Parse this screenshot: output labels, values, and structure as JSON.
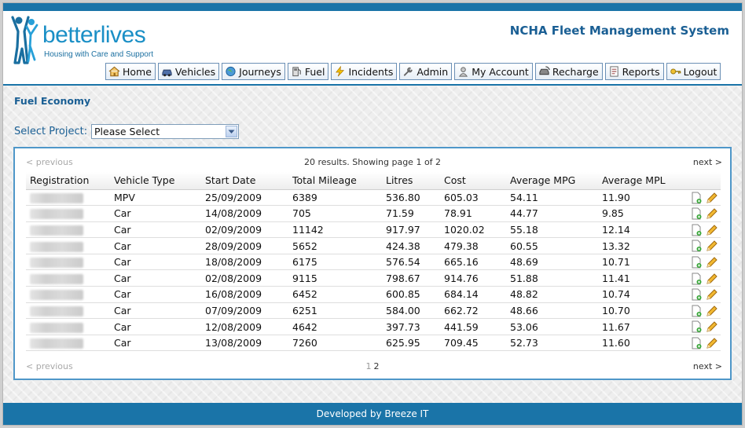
{
  "brand": {
    "name": "betterlives",
    "tagline": "Housing with Care and Support"
  },
  "system_title": "NCHA Fleet Management System",
  "nav": [
    {
      "label": "Home",
      "icon": "home-icon"
    },
    {
      "label": "Vehicles",
      "icon": "car-icon"
    },
    {
      "label": "Journeys",
      "icon": "globe-icon"
    },
    {
      "label": "Fuel",
      "icon": "fuel-pump-icon"
    },
    {
      "label": "Incidents",
      "icon": "lightning-icon"
    },
    {
      "label": "Admin",
      "icon": "wrench-icon"
    },
    {
      "label": "My Account",
      "icon": "user-icon"
    },
    {
      "label": "Recharge",
      "icon": "recharge-icon"
    },
    {
      "label": "Reports",
      "icon": "report-icon"
    },
    {
      "label": "Logout",
      "icon": "key-icon"
    }
  ],
  "page": {
    "heading": "Fuel Economy",
    "project_label": "Select Project:",
    "project_value": "Please Select"
  },
  "pager": {
    "previous": "< previous",
    "next": "next >",
    "summary": "20 results. Showing page 1 of 2",
    "page1": "1",
    "page2": "2"
  },
  "table": {
    "columns": [
      "Registration",
      "Vehicle Type",
      "Start Date",
      "Total Mileage",
      "Litres",
      "Cost",
      "Average MPG",
      "Average MPL"
    ],
    "rows": [
      {
        "type": "MPV",
        "start": "25/09/2009",
        "mileage": "6389",
        "litres": "536.80",
        "cost": "605.03",
        "mpg": "54.11",
        "mpl": "11.90"
      },
      {
        "type": "Car",
        "start": "14/08/2009",
        "mileage": "705",
        "litres": "71.59",
        "cost": "78.91",
        "mpg": "44.77",
        "mpl": "9.85"
      },
      {
        "type": "Car",
        "start": "02/09/2009",
        "mileage": "11142",
        "litres": "917.97",
        "cost": "1020.02",
        "mpg": "55.18",
        "mpl": "12.14"
      },
      {
        "type": "Car",
        "start": "28/09/2009",
        "mileage": "5652",
        "litres": "424.38",
        "cost": "479.38",
        "mpg": "60.55",
        "mpl": "13.32"
      },
      {
        "type": "Car",
        "start": "18/08/2009",
        "mileage": "6175",
        "litres": "576.54",
        "cost": "665.16",
        "mpg": "48.69",
        "mpl": "10.71"
      },
      {
        "type": "Car",
        "start": "02/08/2009",
        "mileage": "9115",
        "litres": "798.67",
        "cost": "914.76",
        "mpg": "51.88",
        "mpl": "11.41"
      },
      {
        "type": "Car",
        "start": "16/08/2009",
        "mileage": "6452",
        "litres": "600.85",
        "cost": "684.14",
        "mpg": "48.82",
        "mpl": "10.74"
      },
      {
        "type": "Car",
        "start": "07/09/2009",
        "mileage": "6251",
        "litres": "584.00",
        "cost": "662.72",
        "mpg": "48.66",
        "mpl": "10.70"
      },
      {
        "type": "Car",
        "start": "12/08/2009",
        "mileage": "4642",
        "litres": "397.73",
        "cost": "441.59",
        "mpg": "53.06",
        "mpl": "11.67"
      },
      {
        "type": "Car",
        "start": "13/08/2009",
        "mileage": "7260",
        "litres": "625.95",
        "cost": "709.45",
        "mpg": "52.73",
        "mpl": "11.60"
      }
    ]
  },
  "footer": "Developed by Breeze IT",
  "colors": {
    "primary_blue": "#1a74a8",
    "heading_blue": "#1a5f94",
    "brand_blue": "#1a8fc6"
  }
}
